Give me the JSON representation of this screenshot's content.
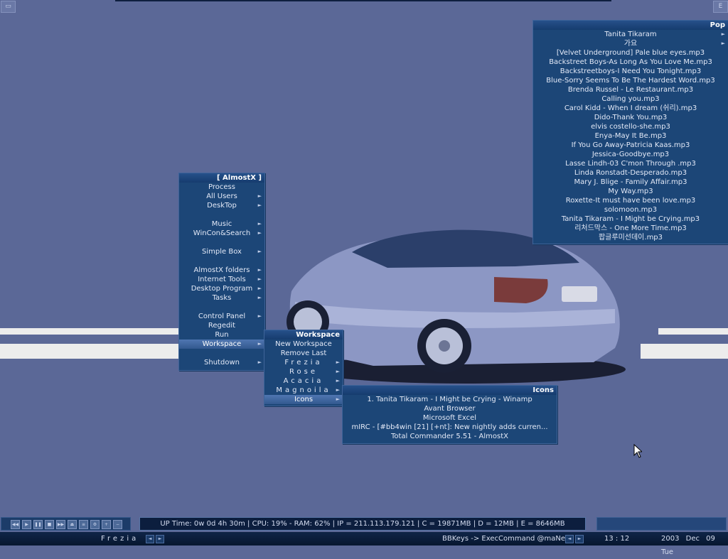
{
  "corner_buttons": {
    "left_icon": "window-icon",
    "right_label": "E"
  },
  "almostx_menu": {
    "title": "[ AlmostX ]",
    "groups": [
      [
        "Process",
        "All Users",
        "DeskTop"
      ],
      [
        "Music",
        "WinCon&Search"
      ],
      [
        "Simple Box"
      ],
      [
        "AlmostX folders",
        "Internet Tools",
        "Desktop Program",
        "Tasks"
      ],
      [
        "Control Panel",
        "Regedit",
        "Run",
        "Workspace"
      ],
      [
        "Shutdown"
      ]
    ]
  },
  "workspace_menu": {
    "title": "Workspace",
    "items": [
      "New Workspace",
      "Remove Last",
      "Frezia",
      "Rose",
      "Acacia",
      "Magnoila",
      "Icons"
    ]
  },
  "icons_menu": {
    "title": "Icons",
    "items": [
      "1. Tanita Tikaram - I Might be Crying - Winamp",
      "Avant Browser",
      "Microsoft Excel",
      "mIRC - [#bb4win [21] [+nt]: New nightly adds curren...",
      "Total Commander 5.51 - AlmostX"
    ]
  },
  "pop_menu": {
    "title": "Pop",
    "items": [
      "Tanita Tikaram",
      "가요",
      "[Velvet Underground] Pale blue eyes.mp3",
      "Backstreet Boys-As Long As You Love Me.mp3",
      "Backstreetboys-I Need You Tonight.mp3",
      "Blue-Sorry Seems To Be The Hardest Word.mp3",
      "Brenda Russel - Le Restaurant.mp3",
      "Calling you.mp3",
      "Carol Kidd - When I dream (쉬리).mp3",
      "Dido-Thank You.mp3",
      "elvis costello-she.mp3",
      "Enya-May It Be.mp3",
      "If You Go Away-Patricia Kaas.mp3",
      "Jessica-Goodbye.mp3",
      "Lasse Lindh-03 C'mon Through .mp3",
      "Linda Ronstadt-Desperado.mp3",
      "Mary J. Blige - Family Affair.mp3",
      "My Way.mp3",
      "Roxette-It must have been love.mp3",
      "solomoon.mp3",
      "Tanita Tikaram - I Might be Crying.mp3",
      "리처드막스 - One More Time.mp3",
      "팝글루미선데이.mp3"
    ]
  },
  "status": {
    "text": "UP Time: 0w 0d 4h 30m   |   CPU: 19% - RAM: 62%   |   IP = 211.113.179.121   |   C = 19871MB   |   D = 12MB   |   E = 8646MB"
  },
  "bottombar": {
    "workspace": "Frezia",
    "command": "BBKeys -> ExecCommand @maNext",
    "clock": "13  :  12",
    "date": "2003 Dec 09 Tue"
  },
  "colors": {
    "desktop": "#5b6897",
    "menu_bg": "#1c4677",
    "highlight": "#4f76b1",
    "bar": "#0c1e3e"
  }
}
